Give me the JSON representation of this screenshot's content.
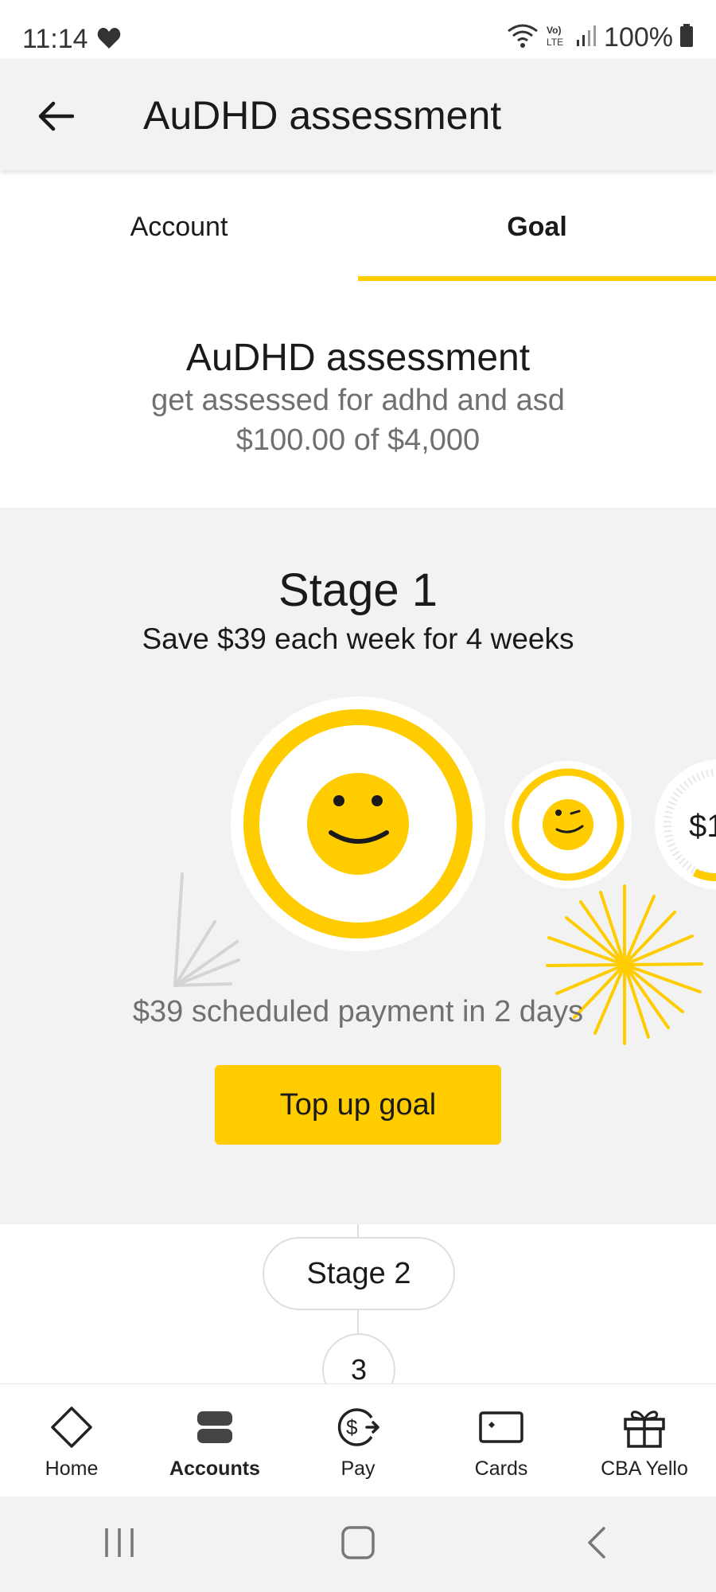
{
  "status_bar": {
    "time": "11:14",
    "battery": "100%",
    "icons": [
      "heart-icon",
      "wifi-icon",
      "volte-icon",
      "signal-icon",
      "battery-icon"
    ]
  },
  "app_bar": {
    "title": "AuDHD assessment",
    "back_icon": "arrow-left-icon"
  },
  "tabs": [
    {
      "label": "Account",
      "selected": false
    },
    {
      "label": "Goal",
      "selected": true
    }
  ],
  "goal": {
    "name": "AuDHD assessment",
    "description": "get assessed for adhd and asd",
    "progress_text": "$100.00 of $4,000",
    "saved": 100.0,
    "target": 4000
  },
  "stage": {
    "title": "Stage 1",
    "subtitle": "Save $39 each week for 4 weeks",
    "next_amount_partial": "$1",
    "scheduled_text": "$39 scheduled payment in 2 days",
    "topup_label": "Top up goal"
  },
  "timeline": {
    "stage2_label": "Stage 2",
    "stage3_label": "3"
  },
  "bottom_nav": [
    {
      "label": "Home",
      "icon": "diamond-home-icon",
      "active": false
    },
    {
      "label": "Accounts",
      "icon": "accounts-icon",
      "active": true
    },
    {
      "label": "Pay",
      "icon": "pay-icon",
      "active": false
    },
    {
      "label": "Cards",
      "icon": "card-icon",
      "active": false
    },
    {
      "label": "CBA Yello",
      "icon": "gift-icon",
      "active": false
    }
  ],
  "system_nav": [
    "recents-icon",
    "home-icon",
    "back-icon"
  ],
  "colors": {
    "accent": "#ffcc00",
    "panel_bg": "#f2f2f2",
    "muted_text": "#707070"
  }
}
